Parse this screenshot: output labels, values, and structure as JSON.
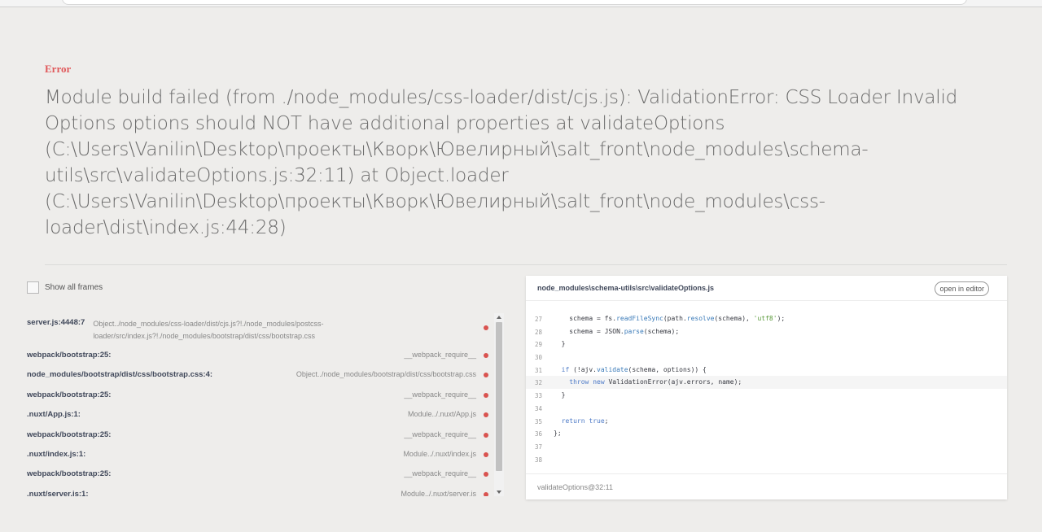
{
  "error": {
    "label": "Error",
    "message": "Module build failed (from ./node_modules/css-loader/dist/cjs.js): ValidationError: CSS Loader Invalid Options options should NOT have additional properties at validateOptions (C:\\Users\\Vanilin\\Desktop\\проекты\\Кворк\\Ювелирный\\salt_front\\node_modules\\schema-utils\\src\\validateOptions.js:32:11) at Object.loader (C:\\Users\\Vanilin\\Desktop\\проекты\\Кворк\\Ювелирный\\salt_front\\node_modules\\css-loader\\dist\\index.js:44:28)"
  },
  "frames_panel": {
    "show_all_label": "Show all frames",
    "frames": [
      {
        "file": "server.js:4448:7",
        "method": "Object../node_modules/css-loader/dist/cjs.js?!./node_modules/postcss-loader/src/index.js?!./node_modules/bootstrap/dist/css/bootstrap.css"
      },
      {
        "file": "webpack/bootstrap:25:",
        "method": "__webpack_require__"
      },
      {
        "file": "node_modules/bootstrap/dist/css/bootstrap.css:4:",
        "method": "Object../node_modules/bootstrap/dist/css/bootstrap.css"
      },
      {
        "file": "webpack/bootstrap:25:",
        "method": "__webpack_require__"
      },
      {
        "file": ".nuxt/App.js:1:",
        "method": "Module../.nuxt/App.js"
      },
      {
        "file": "webpack/bootstrap:25:",
        "method": "__webpack_require__"
      },
      {
        "file": ".nuxt/index.js:1:",
        "method": "Module../.nuxt/index.js"
      },
      {
        "file": "webpack/bootstrap:25:",
        "method": "__webpack_require__"
      },
      {
        "file": ".nuxt/server.js:1:",
        "method": "Module../.nuxt/server.js"
      }
    ]
  },
  "code_panel": {
    "path": "node_modules\\schema-utils\\src\\validateOptions.js",
    "open_editor_label": "open in editor",
    "lines": [
      {
        "n": "27",
        "code": "    schema = fs.readFileSync(path.resolve(schema), 'utf8');"
      },
      {
        "n": "28",
        "code": "    schema = JSON.parse(schema);"
      },
      {
        "n": "29",
        "code": "  }"
      },
      {
        "n": "30",
        "code": ""
      },
      {
        "n": "31",
        "code": "  if (!ajv.validate(schema, options)) {"
      },
      {
        "n": "32",
        "code": "    throw new ValidationError(ajv.errors, name);"
      },
      {
        "n": "33",
        "code": "  }"
      },
      {
        "n": "34",
        "code": ""
      },
      {
        "n": "35",
        "code": "  return true;"
      },
      {
        "n": "36",
        "code": "};"
      },
      {
        "n": "37",
        "code": ""
      },
      {
        "n": "38",
        "code": ""
      }
    ],
    "footer": "validateOptions@32:11"
  },
  "colors": {
    "error_accent": "#e0585a",
    "dot": "#d9534f",
    "background": "#eeedeb"
  }
}
